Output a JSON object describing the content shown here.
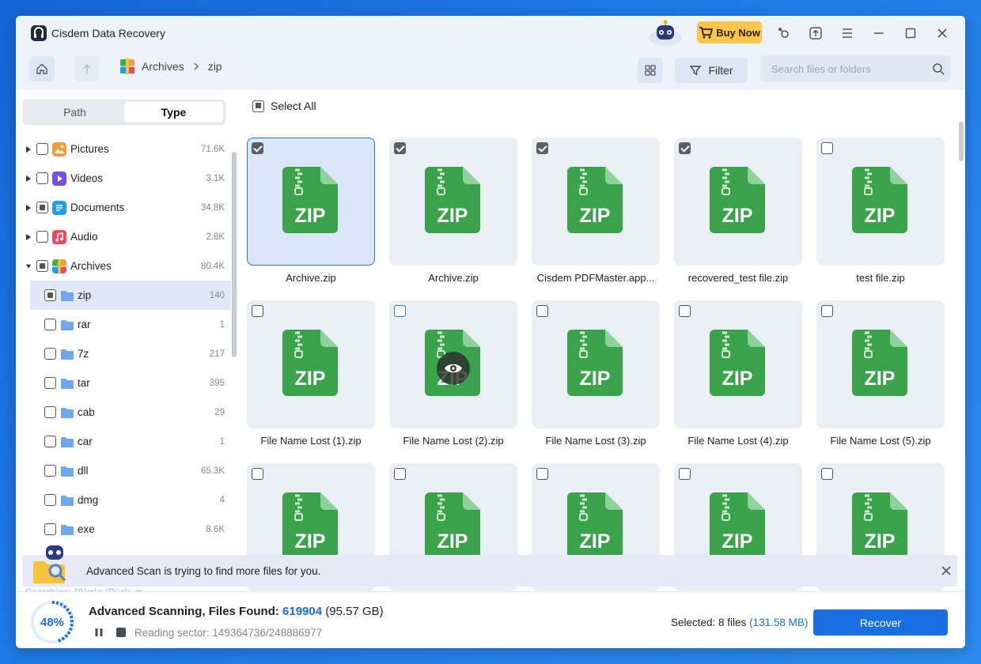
{
  "app": {
    "title": "Cisdem Data Recovery",
    "buy_now": "Buy Now"
  },
  "toolbar": {
    "breadcrumb": [
      "Archives",
      "zip"
    ],
    "filter_label": "Filter",
    "search_placeholder": "Search files or folders"
  },
  "sidebar": {
    "tabs": [
      "Path",
      "Type"
    ],
    "active_tab": "Type",
    "items": [
      {
        "label": "Pictures",
        "count": "71.6K",
        "icon": "pictures-icon",
        "color": "#f39c3a"
      },
      {
        "label": "Videos",
        "count": "3.1K",
        "icon": "videos-icon",
        "color": "#7b4de0"
      },
      {
        "label": "Documents",
        "count": "34.8K",
        "icon": "documents-icon",
        "color": "#1f9de8"
      },
      {
        "label": "Audio",
        "count": "2.8K",
        "icon": "audio-icon",
        "color": "#ee4a5a"
      },
      {
        "label": "Archives",
        "count": "80.4K",
        "icon": "archives-icon",
        "color": "#3fae52"
      }
    ],
    "subitems": [
      {
        "label": "zip",
        "count": "140"
      },
      {
        "label": "rar",
        "count": "1"
      },
      {
        "label": "7z",
        "count": "217"
      },
      {
        "label": "tar",
        "count": "395"
      },
      {
        "label": "cab",
        "count": "29"
      },
      {
        "label": "car",
        "count": "1"
      },
      {
        "label": "dll",
        "count": "65.3K"
      },
      {
        "label": "dmg",
        "count": "4"
      },
      {
        "label": "exe",
        "count": "8.6K"
      }
    ]
  },
  "main": {
    "select_all": "Select All",
    "files": [
      {
        "name": "Archive.zip",
        "checked": true
      },
      {
        "name": "Archive.zip",
        "checked": true
      },
      {
        "name": "Cisdem PDFMaster.app...",
        "checked": true
      },
      {
        "name": "recovered_test file.zip",
        "checked": true
      },
      {
        "name": "test file.zip",
        "checked": false
      },
      {
        "name": "File Name Lost (1).zip",
        "checked": false
      },
      {
        "name": "File Name Lost (2).zip",
        "checked": false
      },
      {
        "name": "File Name Lost (3).zip",
        "checked": false
      },
      {
        "name": "File Name Lost (4).zip",
        "checked": false
      },
      {
        "name": "File Name Lost (5).zip",
        "checked": false
      },
      {
        "name": "",
        "checked": false
      },
      {
        "name": "",
        "checked": false
      },
      {
        "name": "",
        "checked": false
      },
      {
        "name": "",
        "checked": false
      },
      {
        "name": "",
        "checked": false
      }
    ],
    "zip_label": "ZIP"
  },
  "banner": {
    "text": "Advanced Scan is trying to find more files for you."
  },
  "scan_ghost": "Searching: /\\[\\]m\\g (Rück..m...",
  "bottom": {
    "progress_percent": "48%",
    "progress_fraction": 0.48,
    "scan_label": "Advanced Scanning, Files Found: ",
    "files_found": "619904",
    "files_size": " (95.57 GB)",
    "reading": "Reading sector: 149364736/248886977",
    "selected_label": "Selected: 8 files ",
    "selected_size": "(131.58 MB)",
    "recover": "Recover"
  },
  "colors": {
    "accent": "#1a6fe0",
    "zip_green": "#3aa24a",
    "buy": "#ffc64a"
  }
}
